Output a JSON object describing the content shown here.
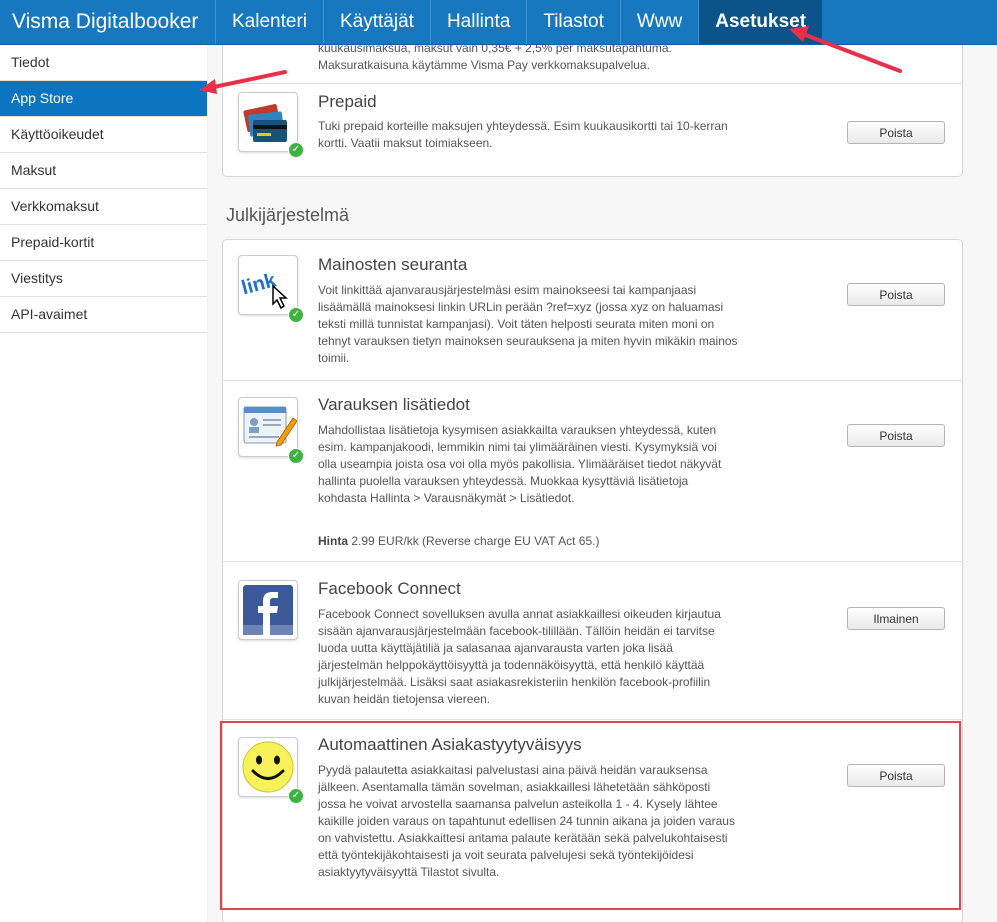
{
  "header": {
    "brand": "Visma Digitalbooker",
    "nav": [
      "Kalenteri",
      "Käyttäjät",
      "Hallinta",
      "Tilastot",
      "Www",
      "Asetukset"
    ],
    "active_nav": "Asetukset"
  },
  "sidebar": {
    "items": [
      "Tiedot",
      "App Store",
      "Käyttöoikeudet",
      "Maksut",
      "Verkkomaksut",
      "Prepaid-kortit",
      "Viestitys",
      "API-avaimet"
    ],
    "active": "App Store"
  },
  "top_card": {
    "partial_line1": "kuukausimaksua, maksut vain 0,35€ + 2,5% per maksutapahtuma.",
    "partial_line2": "Maksuratkaisuna käytämme Visma Pay verkkomaksupalvelua.",
    "prepaid": {
      "title": "Prepaid",
      "desc": "Tuki prepaid korteille maksujen yhteydessä. Esim kuukausikortti tai 10-kerran kortti. Vaatii maksut toimiakseen.",
      "button": "Poista",
      "icon": "credit-cards-icon"
    }
  },
  "section": {
    "heading": "Julkijärjestelmä",
    "items": [
      {
        "title": "Mainosten seuranta",
        "desc": "Voit linkittää ajanvarausjärjestelmäsi esim mainokseesi tai kampanjaasi lisäämällä mainoksesi linkin URLin perään ?ref=xyz (jossa xyz on haluamasi teksti millä tunnistat kampanjasi). Voit täten helposti seurata miten moni on tehnyt varauksen tietyn mainoksen seurauksena ja miten hyvin mikäkin mainos toimii.",
        "button": "Poista",
        "icon": "link-cursor-icon",
        "installed": true
      },
      {
        "title": "Varauksen lisätiedot",
        "desc": "Mahdollistaa lisätietoja kysymisen asiakkailta varauksen yhteydessä, kuten esim. kampanjakoodi, lemmikin nimi tai ylimääräinen viesti. Kysymyksiä voi olla useampia joista osa voi olla myös pakollisia. Ylimääräiset tiedot näkyvät hallinta puolella varauksen yhteydessä. Muokkaa kysyttäviä lisätietoja kohdasta Hallinta > Varausnäkymät > Lisätiedot.",
        "price_label": "Hinta",
        "price_value": "2.99 EUR/kk (Reverse charge EU VAT Act 65.)",
        "button": "Poista",
        "icon": "form-pencil-icon",
        "installed": true
      },
      {
        "title": "Facebook Connect",
        "desc": "Facebook Connect sovelluksen avulla annat asiakkaillesi oikeuden kirjautua sisään ajanvarausjärjestelmään facebook-tilillään. Tällöin heidän ei tarvitse luoda uutta käyttäjätiliä ja salasanaa ajanvarausta varten joka lisää järjestelmän helppokäyttöisyyttä ja todennäköisyyttä, että henkilö käyttää julkijärjestelmää. Lisäksi saat asiakasrekisteriin henkilön facebook-profiilin kuvan heidän tietojensa viereen.",
        "button": "Ilmainen",
        "icon": "facebook-icon",
        "installed": false
      },
      {
        "title": "Automaattinen Asiakastyytyväisyys",
        "desc": "Pyydä palautetta asiakkaitasi palvelustasi aina päivä heidän varauksensa jälkeen. Asentamalla tämän sovelman, asiakkaillesi lähetetään sähköposti jossa he voivat arvostella saamansa palvelun asteikolla 1 - 4. Kysely lähtee kaikille joiden varaus on tapahtunut edellisen 24 tunnin aikana ja joiden varaus on vahvistettu. Asiakkaittesi antama palaute kerätään sekä palvelukohtaisesti että työntekijäkohtaisesti ja voit seurata palvelujesi sekä työntekijöidesi asiaktyytyväisyyttä Tilastot sivulta.",
        "button": "Poista",
        "icon": "smiley-icon",
        "installed": true
      }
    ]
  },
  "colors": {
    "header": "#1778c0",
    "active_nav": "#0c5389",
    "active_sidebar": "#0b75c2",
    "annotation": "#e0464f",
    "installed_check": "#3fb33f"
  }
}
